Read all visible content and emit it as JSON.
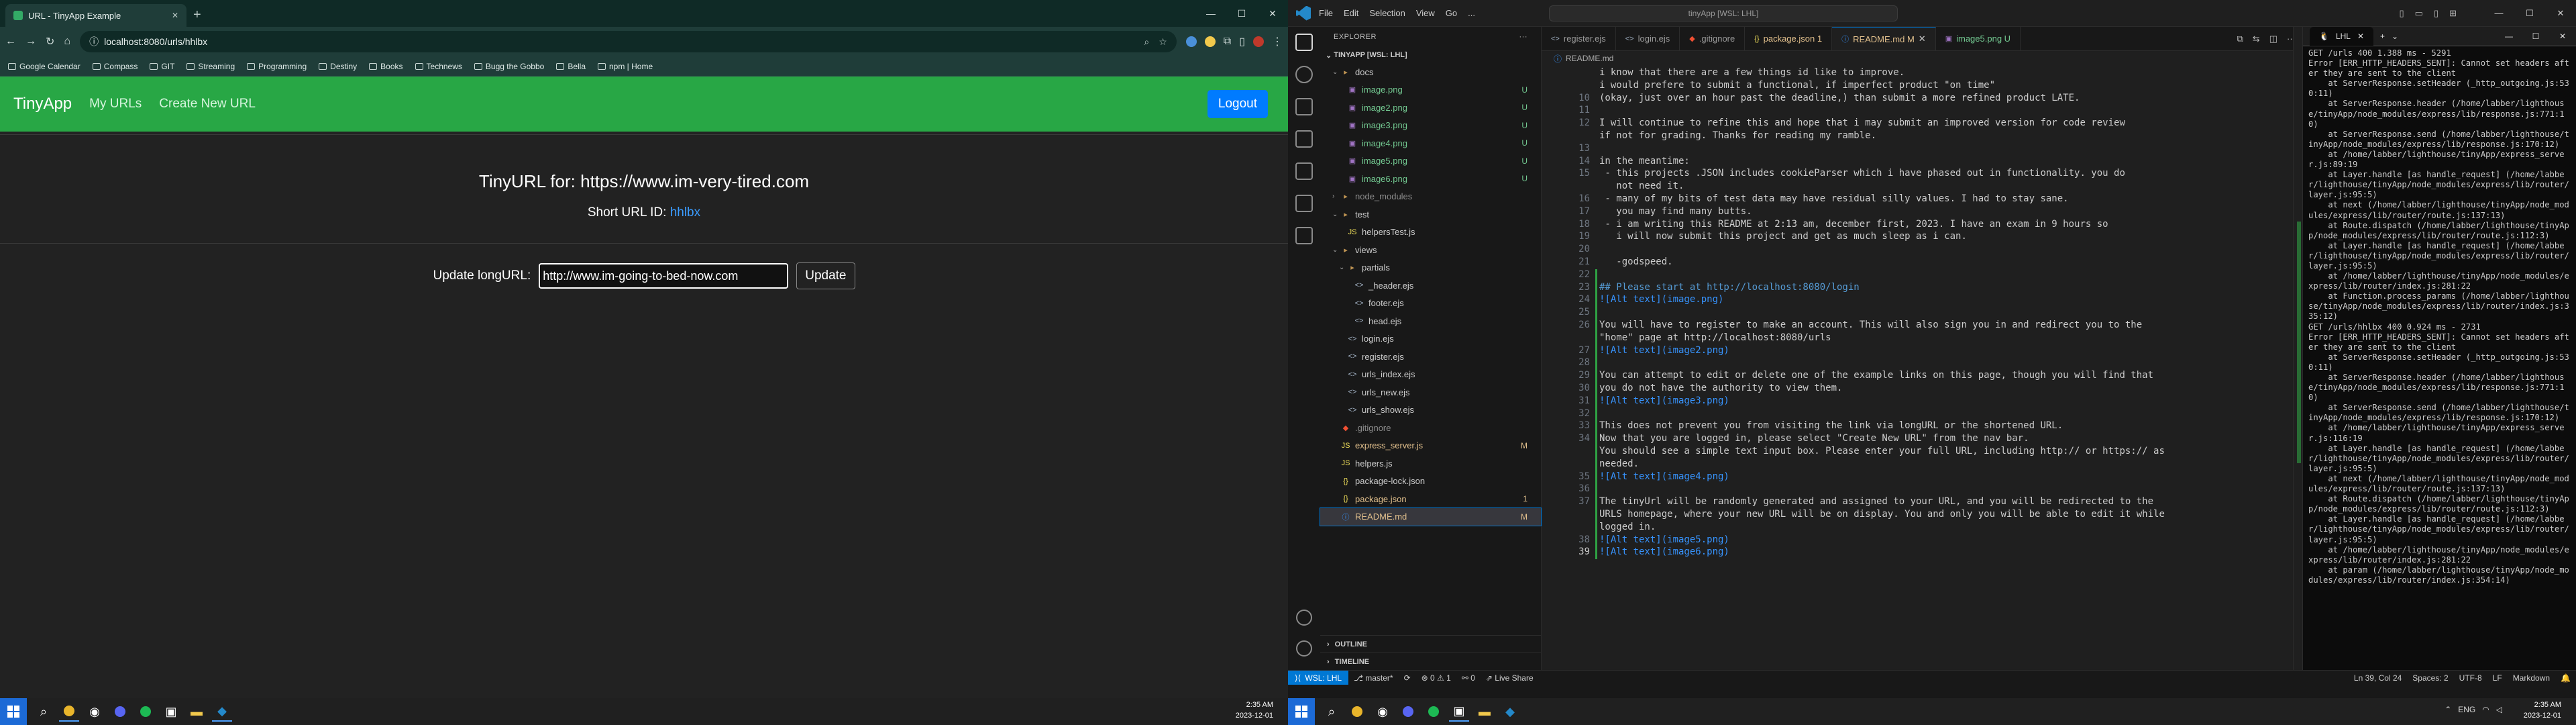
{
  "browser": {
    "tab_title": "URL - TinyApp Example",
    "url": "localhost:8080/urls/hhlbx",
    "bookmarks": [
      "Google Calendar",
      "Compass",
      "GIT",
      "Streaming",
      "Programming",
      "Destiny",
      "Books",
      "Technews",
      "Bugg the Gobbo",
      "Bella",
      "npm | Home"
    ]
  },
  "app": {
    "brand": "TinyApp",
    "nav": {
      "my_urls": "My URLs",
      "create_new": "Create New URL"
    },
    "logout": "Logout",
    "heading": "TinyURL for: https://www.im-very-tired.com",
    "short_label": "Short URL ID: ",
    "short_id": "hhlbx",
    "update_label": "Update longURL:",
    "input_value": "http://www.im-going-to-bed-now.com",
    "update_button": "Update"
  },
  "taskbar": {
    "time": "2:35 AM",
    "date": "2023-12-01",
    "lang": "ENG"
  },
  "vscode": {
    "menu": [
      "File",
      "Edit",
      "Selection",
      "View",
      "Go",
      "..."
    ],
    "search": "tinyApp [WSL: LHL]",
    "explorer": "EXPLORER",
    "root": "TINYAPP [WSL: LHL]",
    "tree": [
      {
        "indent": 1,
        "twisty": "v",
        "icon": "folder",
        "name": "docs",
        "status": "",
        "color": "#cccccc"
      },
      {
        "indent": 2,
        "twisty": "",
        "icon": "img",
        "name": "image.png",
        "status": "U",
        "color": "#73c991"
      },
      {
        "indent": 2,
        "twisty": "",
        "icon": "img",
        "name": "image2.png",
        "status": "U",
        "color": "#73c991"
      },
      {
        "indent": 2,
        "twisty": "",
        "icon": "img",
        "name": "image3.png",
        "status": "U",
        "color": "#73c991"
      },
      {
        "indent": 2,
        "twisty": "",
        "icon": "img",
        "name": "image4.png",
        "status": "U",
        "color": "#73c991"
      },
      {
        "indent": 2,
        "twisty": "",
        "icon": "img",
        "name": "image5.png",
        "status": "U",
        "color": "#73c991"
      },
      {
        "indent": 2,
        "twisty": "",
        "icon": "img",
        "name": "image6.png",
        "status": "U",
        "color": "#73c991"
      },
      {
        "indent": 1,
        "twisty": ">",
        "icon": "folder",
        "name": "node_modules",
        "status": "",
        "color": "#8c8c8c"
      },
      {
        "indent": 1,
        "twisty": "v",
        "icon": "folder",
        "name": "test",
        "status": "",
        "color": "#cccccc"
      },
      {
        "indent": 2,
        "twisty": "",
        "icon": "js",
        "name": "helpersTest.js",
        "status": "",
        "color": "#cccccc"
      },
      {
        "indent": 1,
        "twisty": "v",
        "icon": "folder",
        "name": "views",
        "status": "",
        "color": "#cccccc"
      },
      {
        "indent": 2,
        "twisty": "v",
        "icon": "folder",
        "name": "partials",
        "status": "",
        "color": "#cccccc"
      },
      {
        "indent": 3,
        "twisty": "",
        "icon": "ejs",
        "name": "_header.ejs",
        "status": "",
        "color": "#cccccc"
      },
      {
        "indent": 3,
        "twisty": "",
        "icon": "ejs",
        "name": "footer.ejs",
        "status": "",
        "color": "#cccccc"
      },
      {
        "indent": 3,
        "twisty": "",
        "icon": "ejs",
        "name": "head.ejs",
        "status": "",
        "color": "#cccccc"
      },
      {
        "indent": 2,
        "twisty": "",
        "icon": "ejs",
        "name": "login.ejs",
        "status": "",
        "color": "#cccccc"
      },
      {
        "indent": 2,
        "twisty": "",
        "icon": "ejs",
        "name": "register.ejs",
        "status": "",
        "color": "#cccccc"
      },
      {
        "indent": 2,
        "twisty": "",
        "icon": "ejs",
        "name": "urls_index.ejs",
        "status": "",
        "color": "#cccccc"
      },
      {
        "indent": 2,
        "twisty": "",
        "icon": "ejs",
        "name": "urls_new.ejs",
        "status": "",
        "color": "#cccccc"
      },
      {
        "indent": 2,
        "twisty": "",
        "icon": "ejs",
        "name": "urls_show.ejs",
        "status": "",
        "color": "#cccccc"
      },
      {
        "indent": 1,
        "twisty": "",
        "icon": "git",
        "name": ".gitignore",
        "status": "",
        "color": "#8c8c8c"
      },
      {
        "indent": 1,
        "twisty": "",
        "icon": "js",
        "name": "express_server.js",
        "status": "M",
        "color": "#e2c08d"
      },
      {
        "indent": 1,
        "twisty": "",
        "icon": "js",
        "name": "helpers.js",
        "status": "",
        "color": "#cccccc"
      },
      {
        "indent": 1,
        "twisty": "",
        "icon": "json",
        "name": "package-lock.json",
        "status": "",
        "color": "#cccccc"
      },
      {
        "indent": 1,
        "twisty": "",
        "icon": "json",
        "name": "package.json",
        "status": "1",
        "color": "#e2c08d"
      },
      {
        "indent": 1,
        "twisty": "",
        "icon": "info",
        "name": "README.md",
        "status": "M",
        "color": "#e2c08d",
        "selected": true
      }
    ],
    "outline": "OUTLINE",
    "timeline": "TIMELINE",
    "tabs": [
      {
        "icon": "ejs",
        "name": "register.ejs",
        "active": false,
        "color": "#999999"
      },
      {
        "icon": "ejs",
        "name": "login.ejs",
        "active": false,
        "color": "#999999"
      },
      {
        "icon": "git",
        "name": ".gitignore",
        "active": false,
        "color": "#999999"
      },
      {
        "icon": "json",
        "name": "package.json 1",
        "active": false,
        "color": "#e2c08d"
      },
      {
        "icon": "info",
        "name": "README.md M",
        "active": true,
        "color": "#e2c08d"
      },
      {
        "icon": "img",
        "name": "image5.png U",
        "active": false,
        "color": "#73c991"
      }
    ],
    "breadcrumb": "README.md",
    "code": [
      {
        "n": "",
        "t": "i know that there are a few things id like to improve."
      },
      {
        "n": "",
        "t": "i would prefere to submit a functional, if imperfect product \"on time\""
      },
      {
        "n": "10",
        "t": "(okay, just over an hour past the deadline,) than submit a more refined product LATE."
      },
      {
        "n": "11",
        "t": ""
      },
      {
        "n": "12",
        "t": "I will continue to refine this and hope that i may submit an improved version for code review"
      },
      {
        "n": "",
        "t": "if not for grading. Thanks for reading my ramble."
      },
      {
        "n": "13",
        "t": ""
      },
      {
        "n": "14",
        "t": "in the meantime:"
      },
      {
        "n": "15",
        "t": " - this projects .JSON includes cookieParser which i have phased out in functionality. you do"
      },
      {
        "n": "",
        "t": "   not need it."
      },
      {
        "n": "16",
        "t": " - many of my bits of test data may have residual silly values. I had to stay sane."
      },
      {
        "n": "17",
        "t": "   you may find many butts."
      },
      {
        "n": "18",
        "t": " - i am writing this README at 2:13 am, december first, 2023. I have an exam in 9 hours so"
      },
      {
        "n": "19",
        "t": "   i will now submit this project and get as much sleep as i can."
      },
      {
        "n": "20",
        "t": ""
      },
      {
        "n": "21",
        "t": "   -godspeed."
      },
      {
        "n": "22",
        "t": ""
      },
      {
        "n": "23",
        "t": "## Please start at http://localhost:8080/login",
        "kind": "h"
      },
      {
        "n": "24",
        "t": "![Alt text](image.png)",
        "kind": "img"
      },
      {
        "n": "25",
        "t": ""
      },
      {
        "n": "26",
        "t": "You will have to register to make an account. This will also sign you in and redirect you to the"
      },
      {
        "n": "",
        "t": "\"home\" page at http://localhost:8080/urls"
      },
      {
        "n": "27",
        "t": "![Alt text](image2.png)",
        "kind": "img"
      },
      {
        "n": "28",
        "t": ""
      },
      {
        "n": "29",
        "t": "You can attempt to edit or delete one of the example links on this page, though you will find that"
      },
      {
        "n": "30",
        "t": "you do not have the authority to view them."
      },
      {
        "n": "31",
        "t": "![Alt text](image3.png)",
        "kind": "img"
      },
      {
        "n": "32",
        "t": ""
      },
      {
        "n": "33",
        "t": "This does not prevent you from visiting the link via longURL or the shortened URL."
      },
      {
        "n": "34",
        "t": "Now that you are logged in, please select \"Create New URL\" from the nav bar."
      },
      {
        "n": "",
        "t": "You should see a simple text input box. Please enter your full URL, including http:// or https:// as"
      },
      {
        "n": "",
        "t": "needed."
      },
      {
        "n": "35",
        "t": "![Alt text](image4.png)",
        "kind": "img"
      },
      {
        "n": "36",
        "t": ""
      },
      {
        "n": "37",
        "t": "The tinyUrl will be randomly generated and assigned to your URL, and you will be redirected to the"
      },
      {
        "n": "",
        "t": "URLS homepage, where your new URL will be on display. You and only you will be able to edit it while"
      },
      {
        "n": "",
        "t": "logged in."
      },
      {
        "n": "38",
        "t": "![Alt text](image5.png)",
        "kind": "img"
      },
      {
        "n": "39",
        "t": "![Alt text](image6.png)",
        "kind": "img",
        "cur": true
      }
    ],
    "status": {
      "remote": "WSL: LHL",
      "branch": "master*",
      "problems": "⊗ 0 ⚠ 1",
      "ports": "⚯ 0",
      "live": "Live Share",
      "cursor": "Ln 39, Col 24",
      "spaces": "Spaces: 2",
      "encoding": "UTF-8",
      "eol": "LF",
      "lang": "Markdown"
    }
  },
  "terminal": {
    "title": "LHL",
    "log": "GET /urls 400 1.388 ms - 5291\nError [ERR_HTTP_HEADERS_SENT]: Cannot set headers after they are sent to the client\n    at ServerResponse.setHeader (_http_outgoing.js:530:11)\n    at ServerResponse.header (/home/labber/lighthouse/tinyApp/node_modules/express/lib/response.js:771:10)\n    at ServerResponse.send (/home/labber/lighthouse/tinyApp/node_modules/express/lib/response.js:170:12)\n    at /home/labber/lighthouse/tinyApp/express_server.js:89:19\n    at Layer.handle [as handle_request] (/home/labber/lighthouse/tinyApp/node_modules/express/lib/router/layer.js:95:5)\n    at next (/home/labber/lighthouse/tinyApp/node_modules/express/lib/router/route.js:137:13)\n    at Route.dispatch (/home/labber/lighthouse/tinyApp/node_modules/express/lib/router/route.js:112:3)\n    at Layer.handle [as handle_request] (/home/labber/lighthouse/tinyApp/node_modules/express/lib/router/layer.js:95:5)\n    at /home/labber/lighthouse/tinyApp/node_modules/express/lib/router/index.js:281:22\n    at Function.process_params (/home/labber/lighthouse/tinyApp/node_modules/express/lib/router/index.js:335:12)\nGET /urls/hhlbx 400 0.924 ms - 2731\nError [ERR_HTTP_HEADERS_SENT]: Cannot set headers after they are sent to the client\n    at ServerResponse.setHeader (_http_outgoing.js:530:11)\n    at ServerResponse.header (/home/labber/lighthouse/tinyApp/node_modules/express/lib/response.js:771:10)\n    at ServerResponse.send (/home/labber/lighthouse/tinyApp/node_modules/express/lib/response.js:170:12)\n    at /home/labber/lighthouse/tinyApp/express_server.js:116:19\n    at Layer.handle [as handle_request] (/home/labber/lighthouse/tinyApp/node_modules/express/lib/router/layer.js:95:5)\n    at next (/home/labber/lighthouse/tinyApp/node_modules/express/lib/router/route.js:137:13)\n    at Route.dispatch (/home/labber/lighthouse/tinyApp/node_modules/express/lib/router/route.js:112:3)\n    at Layer.handle [as handle_request] (/home/labber/lighthouse/tinyApp/node_modules/express/lib/router/layer.js:95:5)\n    at /home/labber/lighthouse/tinyApp/node_modules/express/lib/router/index.js:281:22\n    at param (/home/labber/lighthouse/tinyApp/node_modules/express/lib/router/index.js:354:14)"
  }
}
